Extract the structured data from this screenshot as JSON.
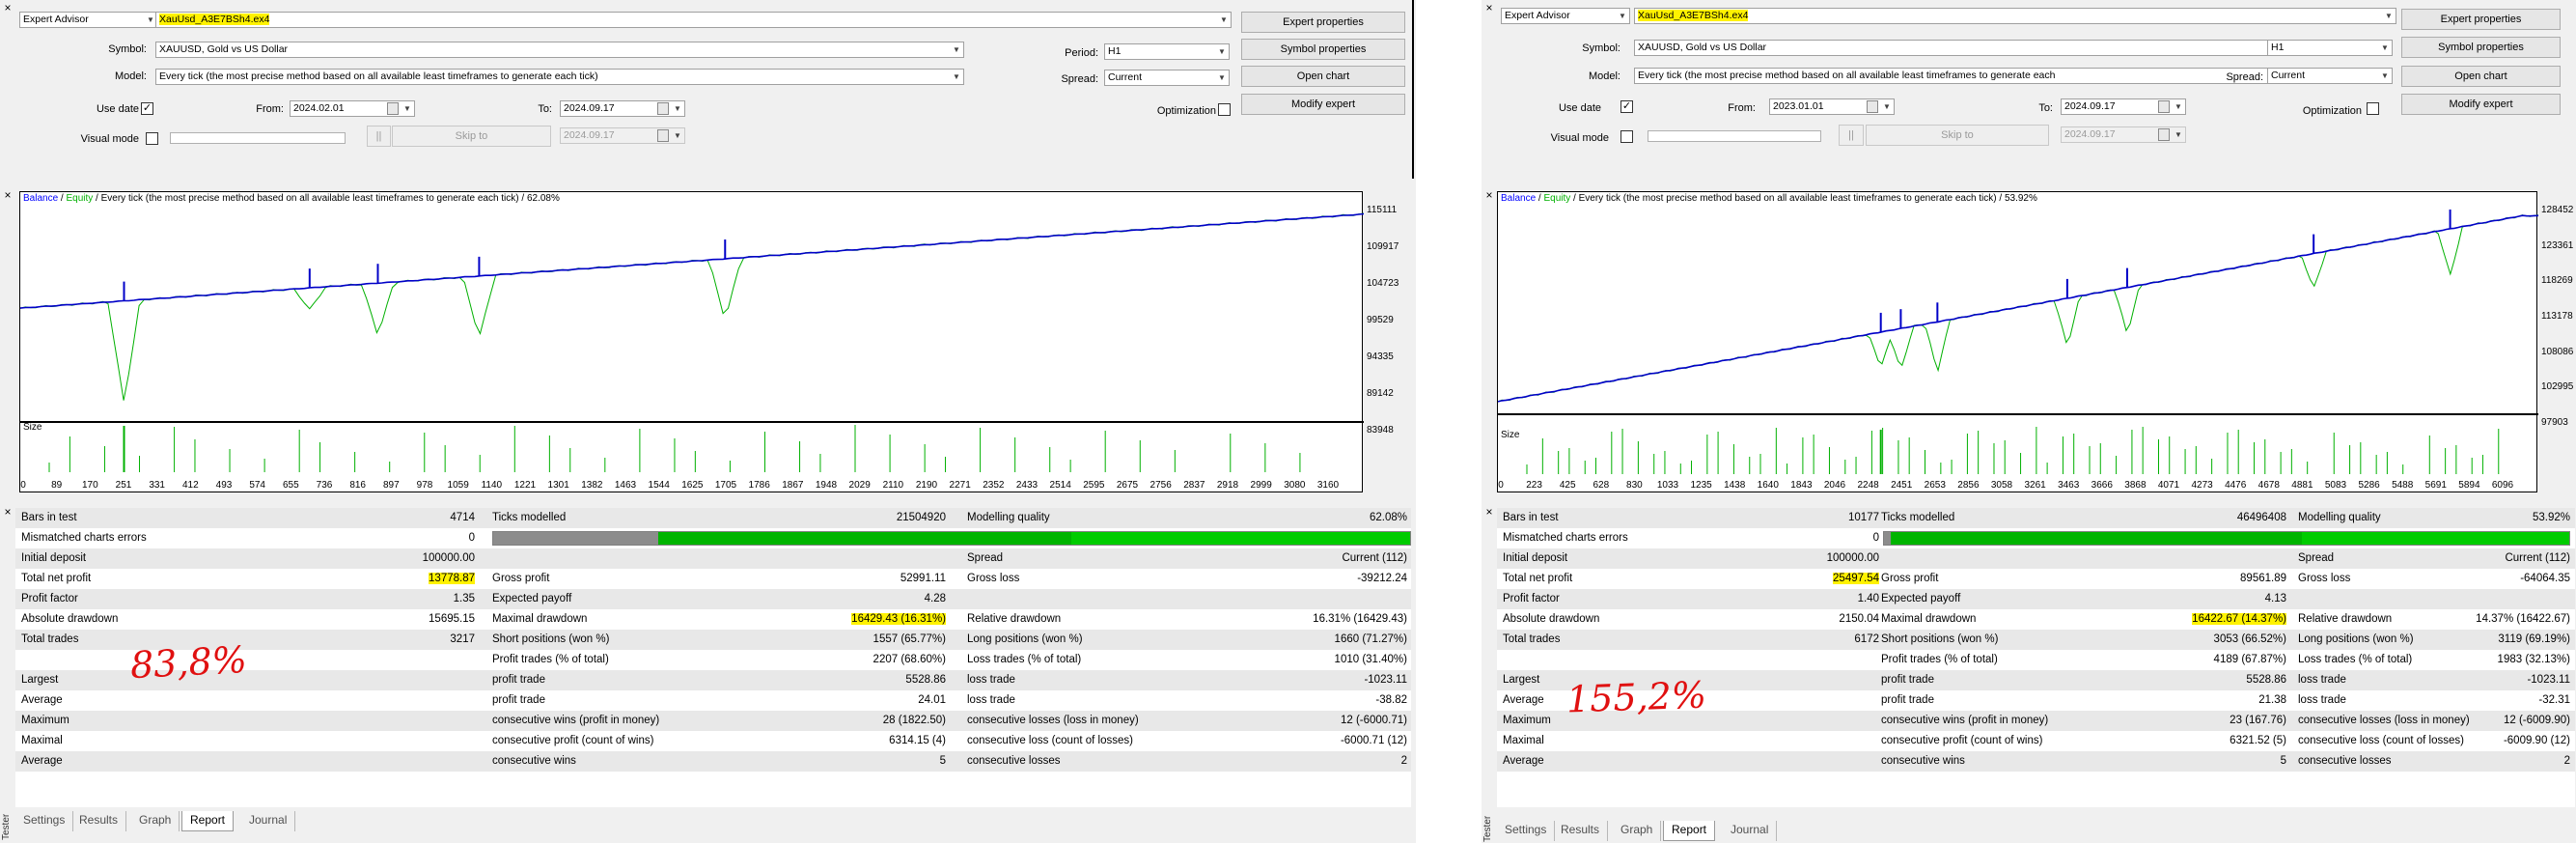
{
  "colors": {
    "balance": "#0000c8",
    "equity": "#00b000",
    "highlight": "#fff200",
    "annotation": "#e01010"
  },
  "panels": [
    {
      "settings": {
        "advisor_type": "Expert Advisor",
        "ea_file": "XauUsd_A3E7BSh4.ex4",
        "symbol_label": "Symbol:",
        "symbol_value": "XAUUSD, Gold vs US Dollar",
        "model_label": "Model:",
        "model_value": "Every tick (the most precise method based on all available least timeframes to generate each tick)",
        "use_date_label": "Use date",
        "from_label": "From:",
        "from_value": "2024.02.01",
        "to_label": "To:",
        "to_value": "2024.09.17",
        "visual_mode_label": "Visual mode",
        "skip_to_label": "Skip to",
        "skip_to_date": "2024.09.17",
        "pause_label": "||",
        "period_label": "Period:",
        "period_value": "H1",
        "spread_label": "Spread:",
        "spread_value": "Current",
        "optimization_label": "Optimization",
        "buttons": {
          "expert_properties": "Expert properties",
          "symbol_properties": "Symbol properties",
          "open_chart": "Open chart",
          "modify_expert": "Modify expert"
        }
      },
      "graph": {
        "caption_balance": "Balance",
        "caption_equity": "Equity",
        "caption_rest": "Every tick (the most precise method based on all available least timeframes to generate each tick) / 62.08%",
        "size_label": "Size",
        "y_ticks": [
          "115111",
          "109917",
          "104723",
          "99529",
          "94335",
          "89142",
          "83948"
        ],
        "x_ticks": [
          "0",
          "89",
          "170",
          "251",
          "331",
          "412",
          "493",
          "574",
          "655",
          "736",
          "816",
          "897",
          "978",
          "1059",
          "1140",
          "1221",
          "1301",
          "1382",
          "1463",
          "1544",
          "1625",
          "1705",
          "1786",
          "1867",
          "1948",
          "2029",
          "2110",
          "2190",
          "2271",
          "2352",
          "2433",
          "2514",
          "2595",
          "2675",
          "2756",
          "2837",
          "2918",
          "2999",
          "3080",
          "3160"
        ]
      },
      "chart_data": {
        "type": "line",
        "series": [
          {
            "name": "Balance",
            "x": [
              0,
              3250
            ],
            "y": [
              101200,
              115700
            ]
          },
          {
            "name": "Equity",
            "x": [
              0,
              3250
            ],
            "y": [
              101200,
              115700
            ]
          }
        ],
        "ylim": [
          83948,
          117000
        ],
        "xlim": [
          0,
          3250
        ],
        "drawdown_spikes": [
          [
            251,
            86500
          ],
          [
            700,
            101000
          ],
          [
            865,
            97000
          ],
          [
            1110,
            96600
          ],
          [
            1705,
            99300
          ]
        ]
      },
      "report": {
        "quality": {
          "grey": 0.18,
          "dark": 0.45
        },
        "rows": [
          [
            "Bars in test",
            "4714",
            "Ticks modelled",
            "21504920",
            "Modelling quality",
            "62.08%"
          ],
          [
            "Mismatched charts errors",
            "0",
            "",
            "",
            "",
            ""
          ],
          [
            "Initial deposit",
            "100000.00",
            "",
            "",
            "Spread",
            "Current (112)"
          ],
          [
            "Total net profit",
            "13778.87",
            "Gross profit",
            "52991.11",
            "Gross loss",
            "-39212.24"
          ],
          [
            "Profit factor",
            "1.35",
            "Expected payoff",
            "4.28",
            "",
            ""
          ],
          [
            "Absolute drawdown",
            "15695.15",
            "Maximal drawdown",
            "16429.43 (16.31%)",
            "Relative drawdown",
            "16.31% (16429.43)"
          ],
          [
            "Total trades",
            "3217",
            "Short positions (won %)",
            "1557 (65.77%)",
            "Long positions (won %)",
            "1660 (71.27%)"
          ],
          [
            "",
            "",
            "Profit trades (% of total)",
            "2207 (68.60%)",
            "Loss trades (% of total)",
            "1010 (31.40%)"
          ],
          [
            "Largest",
            "",
            "profit trade",
            "5528.86",
            "loss trade",
            "-1023.11"
          ],
          [
            "Average",
            "",
            "profit trade",
            "24.01",
            "loss trade",
            "-38.82"
          ],
          [
            "Maximum",
            "",
            "consecutive wins (profit in money)",
            "28 (1822.50)",
            "consecutive losses (loss in money)",
            "12 (-6000.71)"
          ],
          [
            "Maximal",
            "",
            "consecutive profit (count of wins)",
            "6314.15 (4)",
            "consecutive loss (count of losses)",
            "-6000.71 (12)"
          ],
          [
            "Average",
            "",
            "consecutive wins",
            "5",
            "consecutive losses",
            "2"
          ]
        ]
      },
      "annotation": "83,8%",
      "tabs": [
        "Settings",
        "Results",
        "Graph",
        "Report",
        "Journal"
      ],
      "active_tab": "Report",
      "vertical_label": "Tester"
    },
    {
      "settings": {
        "advisor_type": "Expert Advisor",
        "ea_file": "XauUsd_A3E7BSh4.ex4",
        "symbol_label": "Symbol:",
        "symbol_value": "XAUUSD, Gold vs US Dollar",
        "model_label": "Model:",
        "model_value": "Every tick (the most precise method based on all available least timeframes to generate each",
        "use_date_label": "Use date",
        "from_label": "From:",
        "from_value": "2023.01.01",
        "to_label": "To:",
        "to_value": "2024.09.17",
        "visual_mode_label": "Visual mode",
        "skip_to_label": "Skip to",
        "skip_to_date": "2024.09.17",
        "pause_label": "||",
        "period_label": "Period:",
        "period_value": "H1",
        "spread_label": "Spread:",
        "spread_value": "Current",
        "optimization_label": "Optimization",
        "buttons": {
          "expert_properties": "Expert properties",
          "symbol_properties": "Symbol properties",
          "open_chart": "Open chart",
          "modify_expert": "Modify expert"
        }
      },
      "graph": {
        "caption_balance": "Balance",
        "caption_equity": "Equity",
        "caption_rest": "Every tick (the most precise method based on all available least timeframes to generate each tick) / 53.92%",
        "size_label": "Size",
        "y_ticks": [
          "128452",
          "123361",
          "118269",
          "113178",
          "108086",
          "102995",
          "97903"
        ],
        "x_ticks": [
          "0",
          "223",
          "425",
          "628",
          "830",
          "1033",
          "1235",
          "1438",
          "1640",
          "1843",
          "2046",
          "2248",
          "2451",
          "2653",
          "2856",
          "3058",
          "3261",
          "3463",
          "3666",
          "3868",
          "4071",
          "4273",
          "4476",
          "4678",
          "4881",
          "5083",
          "5286",
          "5488",
          "5691",
          "5894",
          "6096"
        ]
      },
      "chart_data": {
        "type": "line",
        "series": [
          {
            "name": "Balance",
            "x": [
              0,
              6150
            ],
            "y": [
              99600,
              128900
            ]
          },
          {
            "name": "Equity",
            "x": [
              0,
              6150
            ],
            "y": [
              99600,
              128900
            ]
          }
        ],
        "ylim": [
          97903,
          130500
        ],
        "xlim": [
          0,
          6250
        ],
        "drawdown_spikes": [
          [
            2300,
            105000
          ],
          [
            2420,
            104500
          ],
          [
            2640,
            104200
          ],
          [
            3420,
            108200
          ],
          [
            3780,
            110200
          ],
          [
            4900,
            117400
          ],
          [
            5720,
            119500
          ]
        ]
      },
      "report": {
        "quality": {
          "grey": 0.01,
          "dark": 0.6
        },
        "rows": [
          [
            "Bars in test",
            "10177",
            "Ticks modelled",
            "46496408",
            "Modelling quality",
            "53.92%"
          ],
          [
            "Mismatched charts errors",
            "0",
            "",
            "",
            "",
            ""
          ],
          [
            "Initial deposit",
            "100000.00",
            "",
            "",
            "Spread",
            "Current (112)"
          ],
          [
            "Total net profit",
            "25497.54",
            "Gross profit",
            "89561.89",
            "Gross loss",
            "-64064.35"
          ],
          [
            "Profit factor",
            "1.40",
            "Expected payoff",
            "4.13",
            "",
            ""
          ],
          [
            "Absolute drawdown",
            "2150.04",
            "Maximal drawdown",
            "16422.67 (14.37%)",
            "Relative drawdown",
            "14.37% (16422.67)"
          ],
          [
            "Total trades",
            "6172",
            "Short positions (won %)",
            "3053 (66.52%)",
            "Long positions (won %)",
            "3119 (69.19%)"
          ],
          [
            "",
            "",
            "Profit trades (% of total)",
            "4189 (67.87%)",
            "Loss trades (% of total)",
            "1983 (32.13%)"
          ],
          [
            "Largest",
            "",
            "profit trade",
            "5528.86",
            "loss trade",
            "-1023.11"
          ],
          [
            "Average",
            "",
            "profit trade",
            "21.38",
            "loss trade",
            "-32.31"
          ],
          [
            "Maximum",
            "",
            "consecutive wins (profit in money)",
            "23 (167.76)",
            "consecutive losses (loss in money)",
            "12 (-6009.90)"
          ],
          [
            "Maximal",
            "",
            "consecutive profit (count of wins)",
            "6321.52 (5)",
            "consecutive loss (count of losses)",
            "-6009.90 (12)"
          ],
          [
            "Average",
            "",
            "consecutive wins",
            "5",
            "consecutive losses",
            "2"
          ]
        ]
      },
      "annotation": "155,2%",
      "tabs": [
        "Settings",
        "Results",
        "Graph",
        "Report",
        "Journal"
      ],
      "active_tab": "Report",
      "vertical_label": "Tester"
    }
  ]
}
